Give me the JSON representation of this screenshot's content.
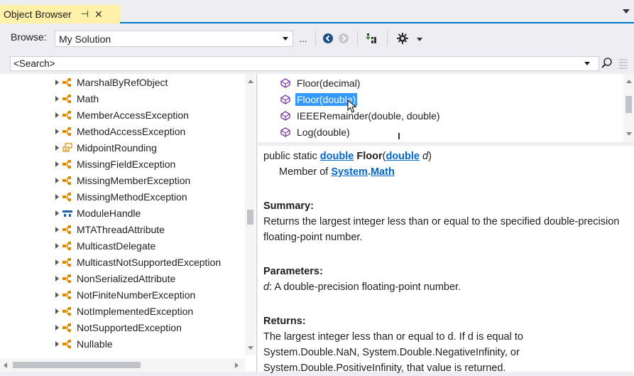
{
  "window": {
    "tab_title": "Object Browser",
    "pin_glyph": "⊣",
    "close_glyph": "✕"
  },
  "toolbar": {
    "browse_label": "Browse:",
    "browse_value": "My Solution",
    "more_label": "..."
  },
  "search": {
    "value": "<Search>"
  },
  "tree": {
    "items": [
      {
        "label": "MarshalByRefObject",
        "icon": "class-icon"
      },
      {
        "label": "Math",
        "icon": "class-icon"
      },
      {
        "label": "MemberAccessException",
        "icon": "class-icon"
      },
      {
        "label": "MethodAccessException",
        "icon": "class-icon"
      },
      {
        "label": "MidpointRounding",
        "icon": "enum-icon"
      },
      {
        "label": "MissingFieldException",
        "icon": "class-icon"
      },
      {
        "label": "MissingMemberException",
        "icon": "class-icon"
      },
      {
        "label": "MissingMethodException",
        "icon": "class-icon"
      },
      {
        "label": "ModuleHandle",
        "icon": "struct-icon"
      },
      {
        "label": "MTAThreadAttribute",
        "icon": "class-icon"
      },
      {
        "label": "MulticastDelegate",
        "icon": "class-icon"
      },
      {
        "label": "MulticastNotSupportedException",
        "icon": "class-icon"
      },
      {
        "label": "NonSerializedAttribute",
        "icon": "class-icon"
      },
      {
        "label": "NotFiniteNumberException",
        "icon": "class-icon"
      },
      {
        "label": "NotImplementedException",
        "icon": "class-icon"
      },
      {
        "label": "NotSupportedException",
        "icon": "class-icon"
      },
      {
        "label": "Nullable",
        "icon": "class-icon"
      }
    ]
  },
  "members": {
    "items": [
      {
        "label": "Floor(decimal)",
        "selected": false
      },
      {
        "label": "Floor(double)",
        "selected": true
      },
      {
        "label": "IEEERemainder(double, double)",
        "selected": false
      },
      {
        "label": "Log(double)",
        "selected": false
      }
    ]
  },
  "description": {
    "sig_prefix": "public static ",
    "sig_return_type": "double",
    "sig_name": "Floor",
    "sig_paren_open": "(",
    "sig_param_type": "double",
    "sig_param_name": "d",
    "sig_paren_close": ")",
    "member_of_label": "Member of ",
    "member_of_ns": "System",
    "member_of_dot": ".",
    "member_of_type": "Math",
    "summary_heading": "Summary:",
    "summary_text": "Returns the largest integer less than or equal to the specified double-precision floating-point number.",
    "parameters_heading": "Parameters:",
    "param_name": "d",
    "param_text": ": A double-precision floating-point number.",
    "returns_heading": "Returns:",
    "returns_line1": "The largest integer less than or equal to d. If d is equal to",
    "returns_line2": "System.Double.NaN, System.Double.NegativeInfinity, or",
    "returns_line3": "System.Double.PositiveInfinity, that value is returned."
  },
  "colors": {
    "accent": "#007acc",
    "tab_active": "#fff1a8",
    "selection": "#3399ff",
    "link": "#0066cc",
    "class_icon": "#d98a00",
    "struct_icon": "#1f5fa8",
    "method_icon": "#7d3fa6"
  }
}
